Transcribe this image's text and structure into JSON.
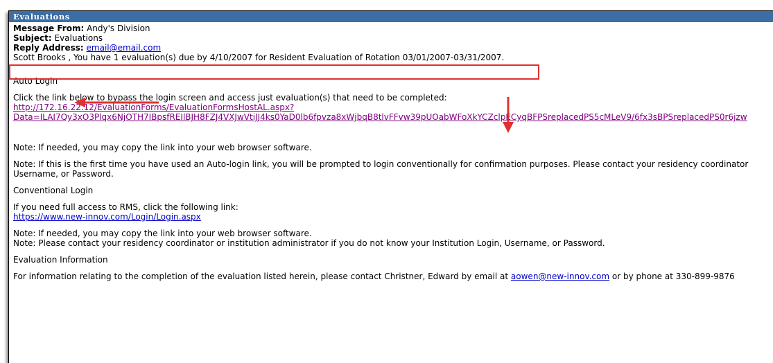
{
  "window": {
    "title": "Evaluations"
  },
  "header": {
    "from_label": "Message From:",
    "from_value": " Andy's Division",
    "subject_label": "Subject:",
    "subject_value": " Evaluations",
    "reply_label": "Reply Address:",
    "reply_value": "email@email.com"
  },
  "body": {
    "highlight_text": "Scott Brooks , You have 1 evaluation(s) due by 4/10/2007 for Resident Evaluation of Rotation 03/01/2007-03/31/2007.",
    "auto_login_heading": "Auto Login",
    "auto_login_instruction": "Click the link below to bypass the login screen and access just evaluation(s) that need to be completed:",
    "auto_link_line1": "http://172.16.22.12/EvaluationForms/EvaluationFormsHostAL.aspx?",
    "auto_link_line2": "Data=ILAI7Qy3xO3Plqx6NjOTH7IBpsfREIlBJH8FZJ4VXJwVtiJJ4ks0YaD0lb6fpvza8xWjbqB8tlvFFvw39pUOabWFoXkYCZclpECyqBFPSreplacedPS5cMLeV9/6fx3sBPSreplacedPS0r6jzw",
    "note_copy_1": "Note: If needed, you may copy the link into your web browser software.",
    "note_first_time_1": "Note: If this is the first time you have used an Auto-login link, you will be prompted to login conventionally for confirmation purposes. Please contact your residency coordinator",
    "note_first_time_2": "Username, or Password.",
    "conventional_heading": "Conventional Login",
    "conventional_instruction": "If you need full access to RMS, click the following link:",
    "conventional_link": "https://www.new-innov.com/Login/Login.aspx",
    "note_copy_2": "Note: If needed, you may copy the link into your web browser software.",
    "note_contact": "Note: Please contact your residency coordinator or institution administrator if you do not know your Institution Login, Username, or Password.",
    "eval_info_heading": "Evaluation Information",
    "eval_info_prefix": "For information relating to the completion of the evaluation listed herein, please contact Christner, Edward by email at ",
    "eval_info_email": "aowen@new-innov.com",
    "eval_info_suffix": " or by phone at 330-899-9876"
  },
  "colors": {
    "titlebar": "#3a6ea5",
    "link": "#0000cc",
    "visited_link": "#800080",
    "annotation": "#e03030"
  }
}
